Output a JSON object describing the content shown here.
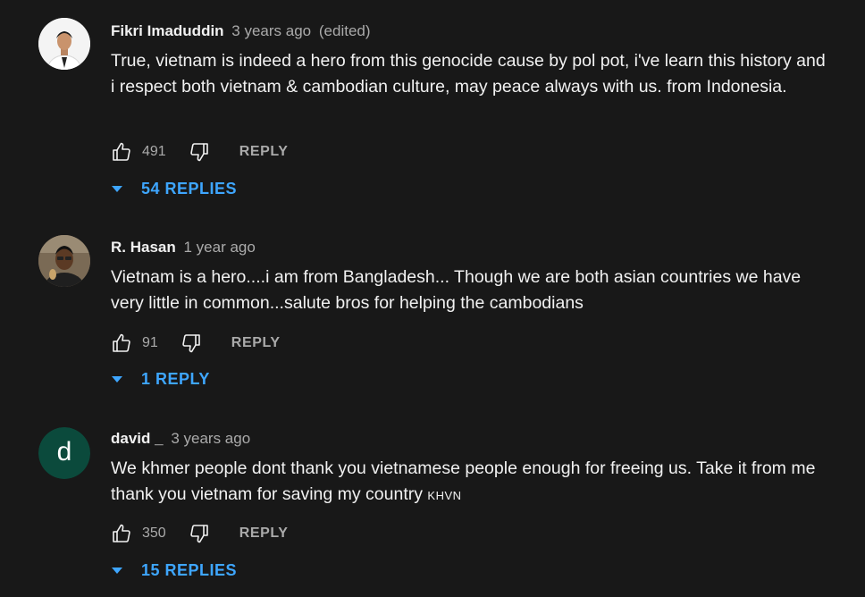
{
  "comments": [
    {
      "author": "Fikri Imaduddin",
      "time": "3 years ago",
      "edited": "(edited)",
      "text": "True, vietnam is indeed a hero from this genocide cause by pol pot, i've learn this history and i respect both vietnam & cambodian culture, may peace always with us. from Indonesia.",
      "likes": "491",
      "reply_label": "REPLY",
      "replies_label": "54 REPLIES"
    },
    {
      "author": "R. Hasan",
      "time": "1 year ago",
      "text": "Vietnam is a hero....i am from Bangladesh... Though we are both asian countries we have very little in common...salute bros for helping the cambodians",
      "likes": "91",
      "reply_label": "REPLY",
      "replies_label": "1 REPLY"
    },
    {
      "author": "david _",
      "time": "3 years ago",
      "avatar_letter": "d",
      "avatar_color": "#0b4a3c",
      "text": "We khmer people dont thank you vietnamese people enough for freeing us. Take it from me thank you vietnam for saving my country",
      "text_suffix": "KHVN",
      "likes": "350",
      "reply_label": "REPLY",
      "replies_label": "15 REPLIES"
    }
  ],
  "colors": {
    "background": "#181818",
    "link": "#3ea6ff",
    "muted": "#aaaaaa"
  },
  "icons": {
    "like": "thumb-up-icon",
    "dislike": "thumb-down-icon",
    "expand": "caret-down-icon"
  }
}
